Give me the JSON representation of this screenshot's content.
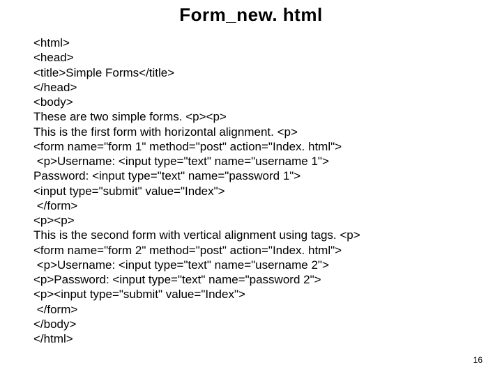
{
  "title": "Form_new. html",
  "code_lines": [
    "<html>",
    "<head>",
    "<title>Simple Forms</title>",
    "</head>",
    "<body>",
    "These are two simple forms. <p><p>",
    "This is the first form with horizontal alignment. <p>",
    "<form name=\"form 1\" method=\"post\" action=\"Index. html\">",
    " <p>Username: <input type=\"text\" name=\"username 1\">",
    "Password: <input type=\"text\" name=\"password 1\">",
    "<input type=\"submit\" value=\"Index\">",
    " </form>",
    "<p><p>",
    "This is the second form with vertical alignment using tags. <p>",
    "<form name=\"form 2\" method=\"post\" action=\"Index. html\">",
    " <p>Username: <input type=\"text\" name=\"username 2\">",
    "<p>Password: <input type=\"text\" name=\"password 2\">",
    "<p><input type=\"submit\" value=\"Index\">",
    " </form>",
    "</body>",
    "</html>"
  ],
  "page_number": "16"
}
